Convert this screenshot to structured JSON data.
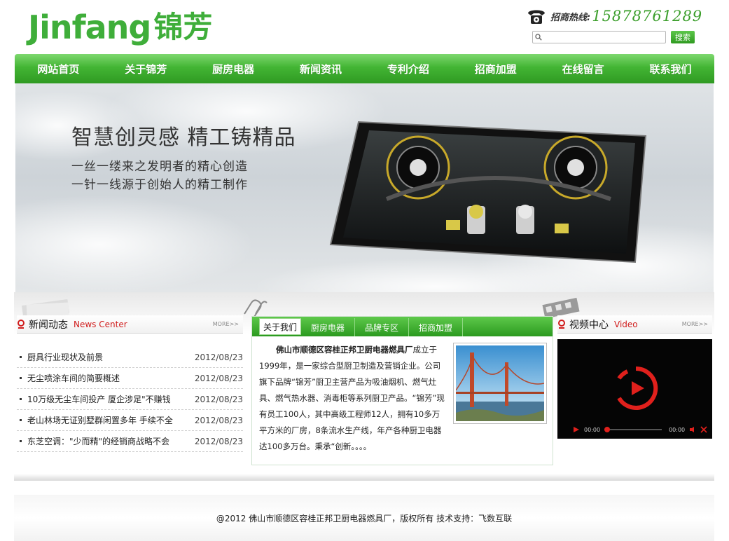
{
  "header": {
    "logo_en": "Jinfang",
    "logo_cn": "锦芳",
    "hotline_label": "招商热线:",
    "hotline_number": "15878761289",
    "search_placeholder": "",
    "search_button": "搜索"
  },
  "nav": [
    "网站首页",
    "关于锦芳",
    "厨房电器",
    "新闻资讯",
    "专利介绍",
    "招商加盟",
    "在线留言",
    "联系我们"
  ],
  "banner": {
    "title": "智慧创灵感 精工铸精品",
    "line1": "一丝一缕来之发明者的精心创造",
    "line2": "一针一线源于创始人的精工制作"
  },
  "news": {
    "title": "新闻动态",
    "subtitle": "News Center",
    "more": "MORE>>",
    "items": [
      {
        "title": "厨具行业现状及前景",
        "date": "2012/08/23"
      },
      {
        "title": "无尘喷涂车间的简要概述",
        "date": "2012/08/23"
      },
      {
        "title": "10万级无尘车间投产 厦企涉足\"不赚钱",
        "date": "2012/08/23"
      },
      {
        "title": "老山林场无证别墅群闲置多年 手续不全",
        "date": "2012/08/23"
      },
      {
        "title": "东芝空调：\"少而精\"的经销商战略不会",
        "date": "2012/08/23"
      }
    ]
  },
  "about": {
    "tabs": [
      "关于我们",
      "厨房电器",
      "品牌专区",
      "招商加盟"
    ],
    "company": "佛山市顺德区容桂正邦卫厨电器燃具厂",
    "text": "成立于1999年，是一家综合型厨卫制造及营销企业。公司旗下品牌“锦芳”厨卫主营产品为吸油烟机、燃气灶具、燃气热水器、消毒柜等系列厨卫产品。“锦芳”现有员工100人，其中高级工程师12人，拥有10多万平方米的厂房，8条流水生产线，年产各种厨卫电器达100多万台。秉承“创新。。。。"
  },
  "video": {
    "title": "视频中心",
    "subtitle": "Video",
    "more": "MORE>>",
    "time_current": "00:00",
    "time_total": "00:00"
  },
  "footer": {
    "text": "@2012  佛山市顺德区容桂正邦卫厨电器燃具厂，版权所有 技术支持：飞数互联"
  },
  "colors": {
    "brand_green": "#3fae3a",
    "nav_green": "#2f9a22",
    "accent_red": "#d01c1c"
  }
}
